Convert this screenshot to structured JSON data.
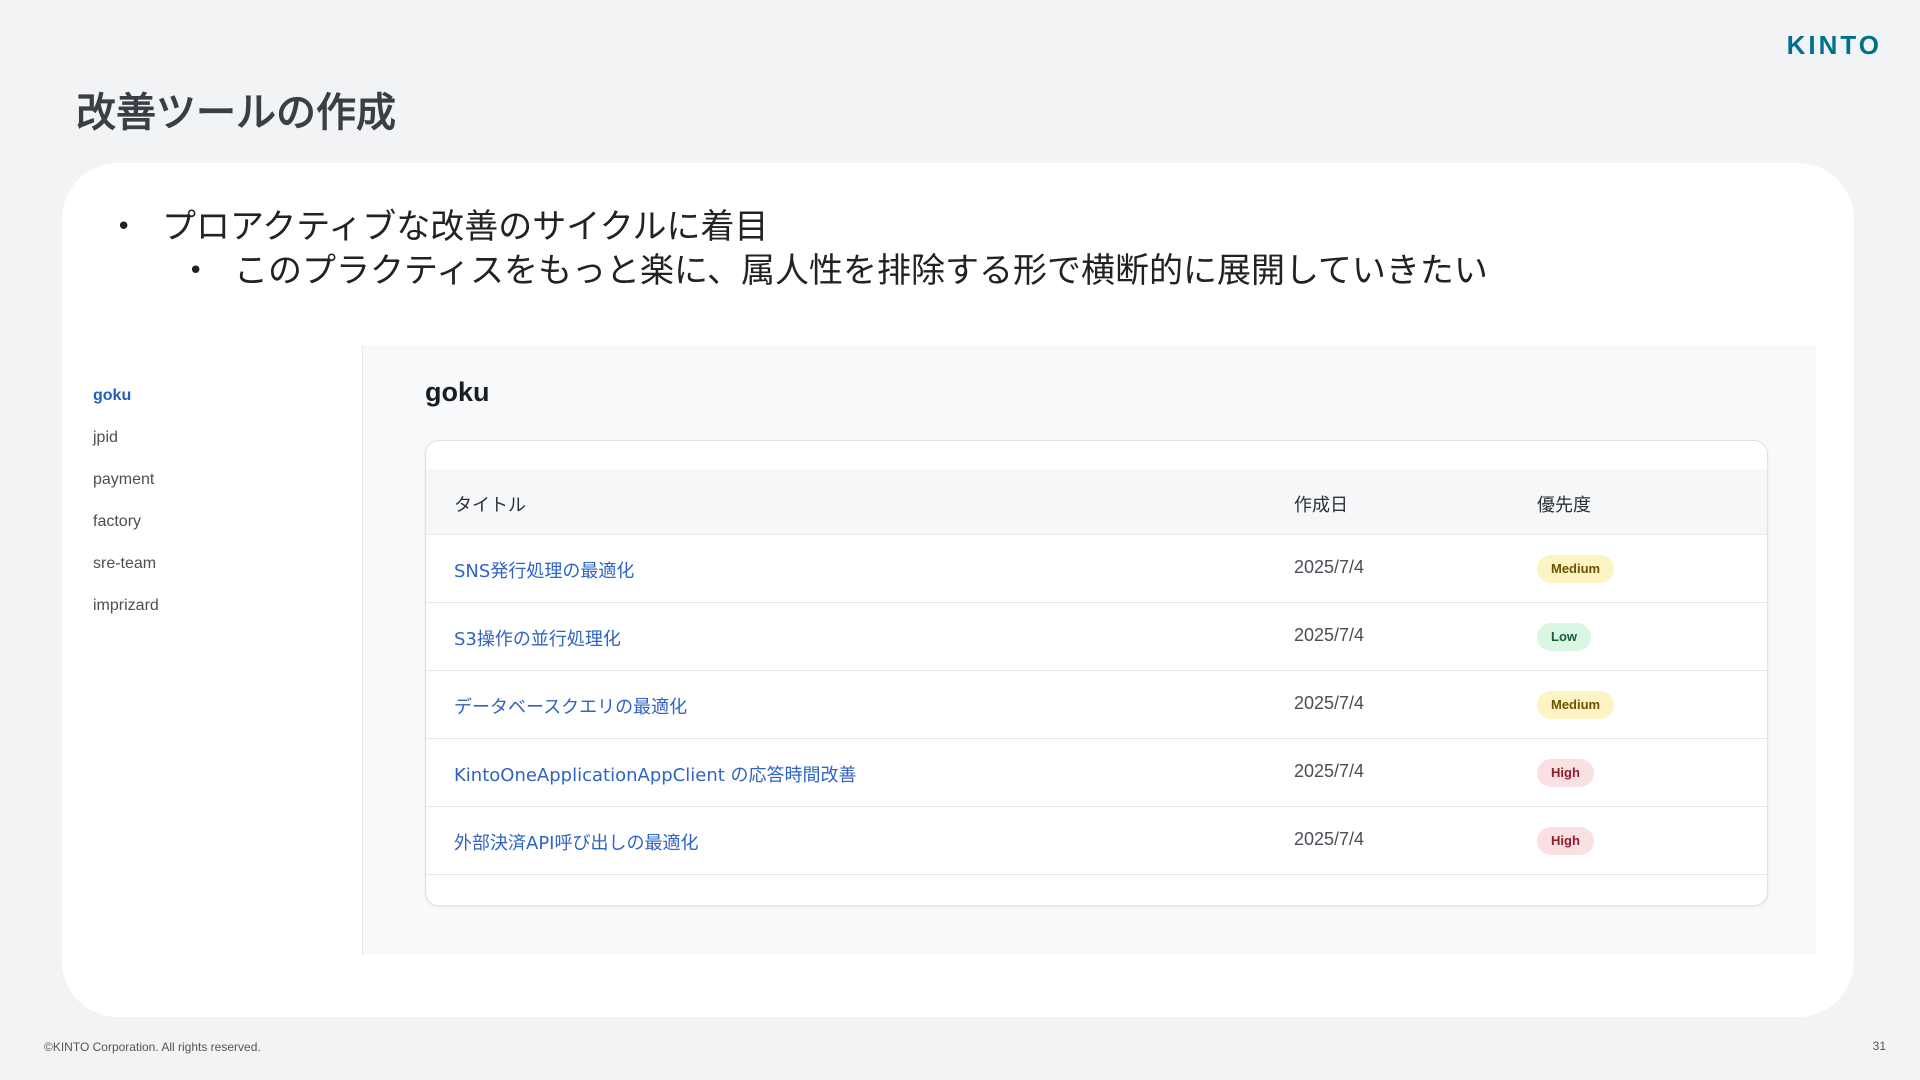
{
  "slide": {
    "logo": "KINTO",
    "title": "改善ツールの作成",
    "bullets": {
      "level1": "プロアクティブな改善のサイクルに着目",
      "level2": "このプラクティスをもっと楽に、属人性を排除する形で横断的に展開していきたい"
    },
    "copyright": "©KINTO Corporation. All rights reserved.",
    "page_number": "31"
  },
  "sidebar": {
    "items": [
      {
        "label": "goku",
        "active": true
      },
      {
        "label": "jpid",
        "active": false
      },
      {
        "label": "payment",
        "active": false
      },
      {
        "label": "factory",
        "active": false
      },
      {
        "label": "sre-team",
        "active": false
      },
      {
        "label": "imprizard",
        "active": false
      }
    ]
  },
  "main": {
    "project_title": "goku",
    "table": {
      "headers": {
        "title": "タイトル",
        "date": "作成日",
        "priority": "優先度"
      },
      "rows": [
        {
          "title": "SNS発行処理の最適化",
          "date": "2025/7/4",
          "priority": "Medium"
        },
        {
          "title": "S3操作の並行処理化",
          "date": "2025/7/4",
          "priority": "Low"
        },
        {
          "title": "データベースクエリの最適化",
          "date": "2025/7/4",
          "priority": "Medium"
        },
        {
          "title": "KintoOneApplicationAppClient の応答時間改善",
          "date": "2025/7/4",
          "priority": "High"
        },
        {
          "title": "外部決済API呼び出しの最適化",
          "date": "2025/7/4",
          "priority": "High"
        }
      ]
    }
  },
  "colors": {
    "brand": "#00708d",
    "link": "#2f63c4",
    "medium_badge": "#fdf4c4",
    "low_badge": "#dcf6e4",
    "high_badge": "#fbe0e3"
  }
}
